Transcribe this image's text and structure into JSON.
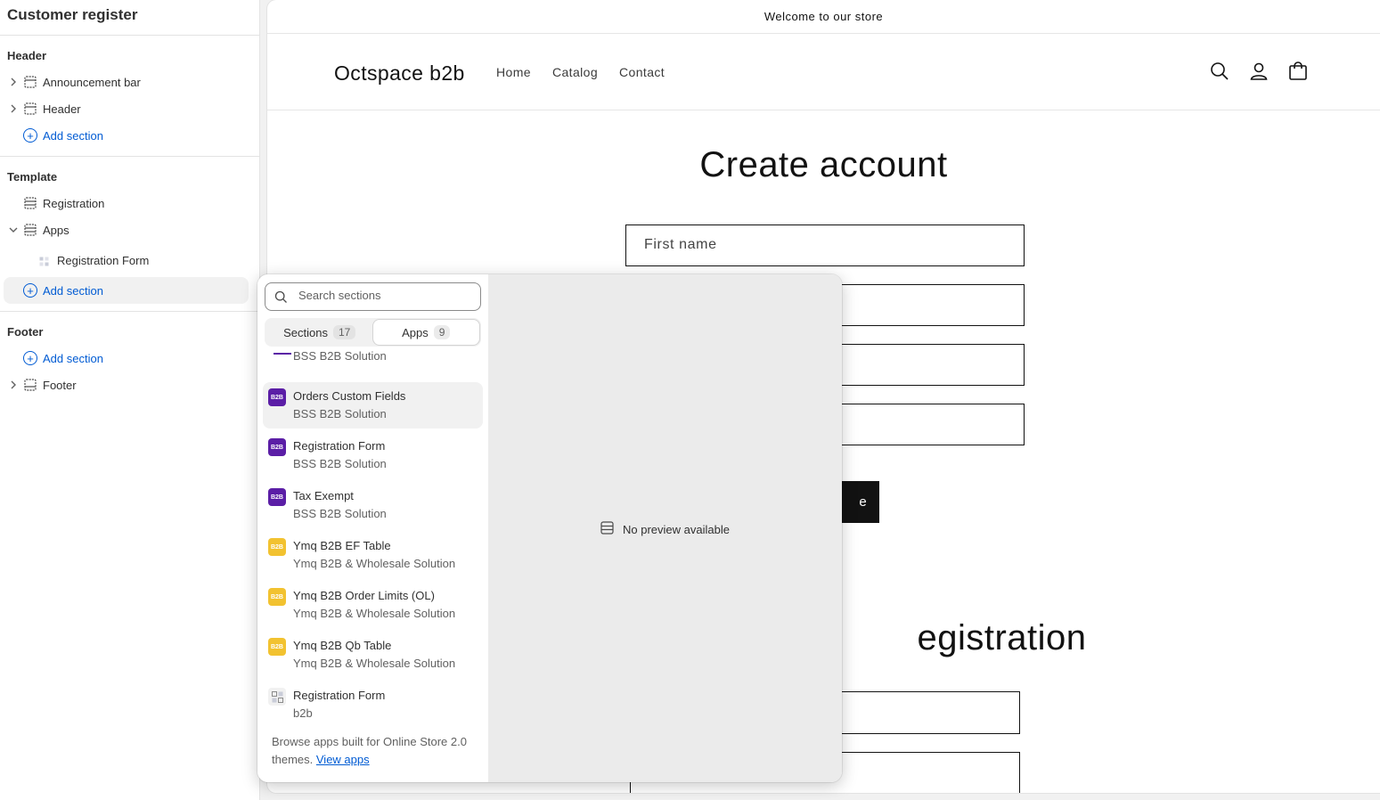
{
  "sidebar": {
    "title": "Customer register",
    "groups": [
      {
        "title": "Header",
        "items": [
          {
            "label": "Announcement bar"
          },
          {
            "label": "Header"
          }
        ],
        "add_label": "Add section"
      },
      {
        "title": "Template",
        "items": [
          {
            "label": "Registration"
          },
          {
            "label": "Apps"
          },
          {
            "label": "Registration Form"
          }
        ],
        "add_label": "Add section"
      },
      {
        "title": "Footer",
        "add_label": "Add section",
        "items": [
          {
            "label": "Footer"
          }
        ]
      }
    ]
  },
  "store": {
    "announcement": "Welcome to our store",
    "logo": "Octspace b2b",
    "nav": [
      "Home",
      "Catalog",
      "Contact"
    ],
    "heading": "Create account",
    "first_name_placeholder": "First name",
    "button_text_partial": "e",
    "heading2_partial": "egistration"
  },
  "popover": {
    "search_placeholder": "Search sections",
    "tabs": [
      {
        "label": "Sections",
        "count": "17"
      },
      {
        "label": "Apps",
        "count": "9"
      }
    ],
    "partial_item_vendor": "BSS B2B Solution",
    "items": [
      {
        "name": "Orders Custom Fields",
        "vendor": "BSS B2B Solution",
        "icon": "bss-icon"
      },
      {
        "name": "Registration Form",
        "vendor": "BSS B2B Solution",
        "icon": "bss-icon"
      },
      {
        "name": "Tax Exempt",
        "vendor": "BSS B2B Solution",
        "icon": "bss-icon"
      },
      {
        "name": "Ymq B2B EF Table",
        "vendor": "Ymq B2B & Wholesale Solution",
        "icon": "ymq-icon"
      },
      {
        "name": "Ymq B2B Order Limits (OL)",
        "vendor": "Ymq B2B & Wholesale Solution",
        "icon": "ymq-icon"
      },
      {
        "name": "Ymq B2B Qb Table",
        "vendor": "Ymq B2B & Wholesale Solution",
        "icon": "ymq-icon"
      },
      {
        "name": "Registration Form",
        "vendor": "b2b",
        "icon": "app-block-icon"
      }
    ],
    "footer_text": "Browse apps built for Online Store 2.0 themes.",
    "footer_link": "View apps",
    "no_preview": "No preview available"
  },
  "colors": {
    "accent": "#005bd3",
    "bss_brand": "#5b1ea6",
    "ymq_brand": "#f2c230"
  }
}
